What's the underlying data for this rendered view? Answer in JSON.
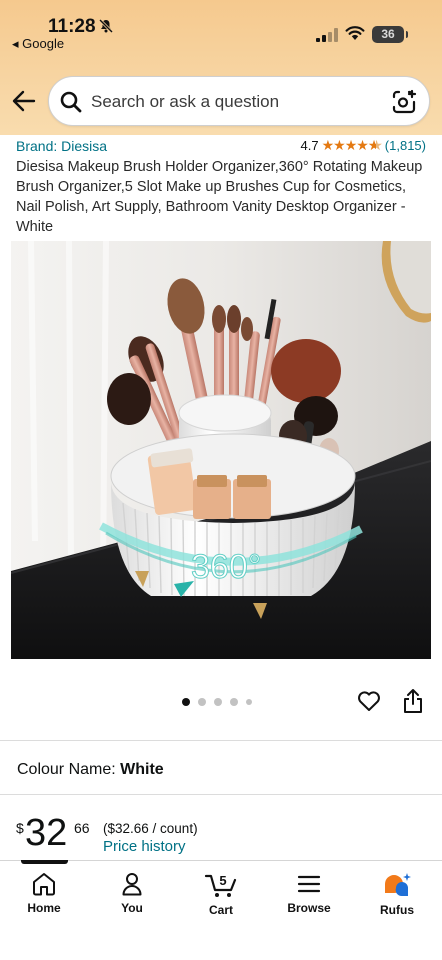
{
  "status_bar": {
    "time": "11:28",
    "back_app": "◂ Google",
    "battery": "36"
  },
  "header": {
    "search_placeholder": "Search or ask a question"
  },
  "product": {
    "brand": "Brand: Diesisa",
    "rating_value": "4.7",
    "rating_stars": 4.5,
    "rating_count": "(1,815)",
    "title": "Diesisa Makeup Brush Holder Organizer,360° Rotating Makeup Brush Organizer,5 Slot Make up Brushes Cup for Cosmetics, Nail Polish, Art Supply, Bathroom Vanity Desktop Organizer - White",
    "image_overlay_text": "360°",
    "image_count": 5,
    "image_active_index": 0
  },
  "variation": {
    "label": "Colour Name:",
    "value": "White"
  },
  "price": {
    "symbol": "$",
    "whole": "32",
    "fraction": "66",
    "unit_price": "($32.66 / count)",
    "history_link": "Price history"
  },
  "bottom_nav": {
    "items": [
      {
        "label": "Home",
        "icon": "home-icon"
      },
      {
        "label": "You",
        "icon": "person-icon"
      },
      {
        "label": "Cart",
        "icon": "cart-icon",
        "badge": "5"
      },
      {
        "label": "Browse",
        "icon": "menu-icon"
      },
      {
        "label": "Rufus",
        "icon": "rufus-icon"
      }
    ],
    "active_index": 0
  },
  "colors": {
    "header_bg": "#f7d4a1",
    "link": "#007185",
    "star": "#e47911",
    "rufus_orange": "#f27a1a",
    "rufus_blue": "#1f6fd6"
  }
}
